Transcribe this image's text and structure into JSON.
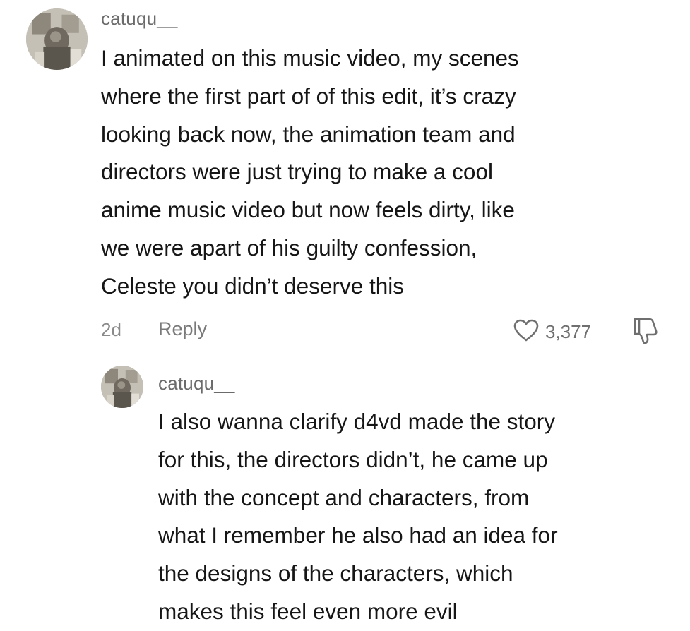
{
  "comment": {
    "username": "catuqu__",
    "text": "I animated on this music video, my scenes\nwhere the first part of of this edit, it’s crazy\nlooking back now, the animation team and\ndirectors were just trying to make a cool\nanime music video but now feels dirty, like\nwe were apart of his guilty confession,\nCeleste you didn’t deserve this",
    "time": "2d",
    "reply_label": "Reply",
    "like_count": "3,377",
    "like_icon": "heart-outline-icon",
    "dislike_icon": "thumbs-down-outline-icon"
  },
  "reply": {
    "username": "catuqu__",
    "text": "I also wanna clarify d4vd made the story\nfor this, the directors didn’t, he came up\nwith the concept and characters, from\nwhat I remember he also had an idea for\nthe designs of the characters, which\nmakes this feel even more evil"
  }
}
